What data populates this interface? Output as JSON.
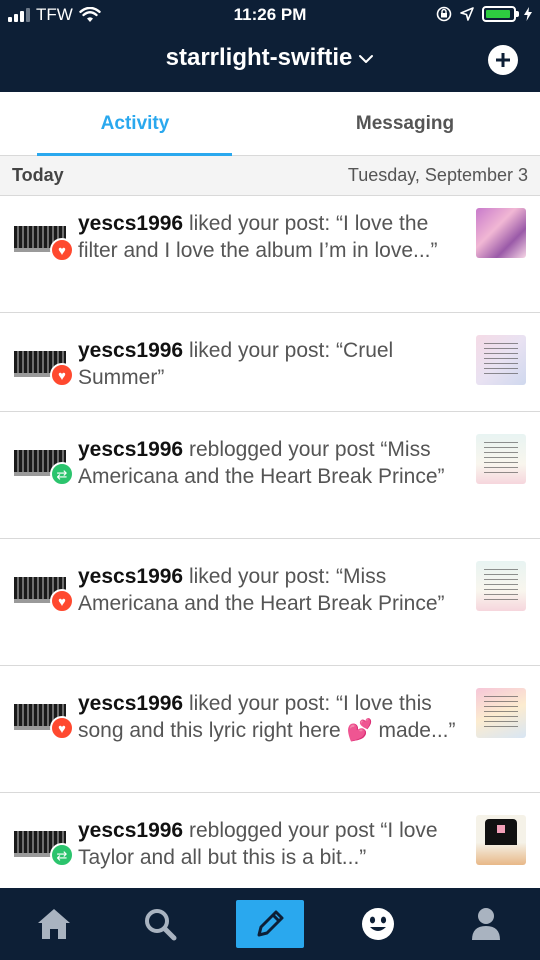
{
  "status_bar": {
    "carrier": "TFW",
    "time": "11:26 PM"
  },
  "header": {
    "blog_name": "starrlight-swiftie",
    "dropdown_icon": "chevron-down-icon",
    "compose_icon": "plus-circle-icon"
  },
  "tabs": [
    {
      "label": "Activity",
      "active": true
    },
    {
      "label": "Messaging",
      "active": false
    }
  ],
  "section": {
    "title": "Today",
    "date": "Tuesday, September 3"
  },
  "notifications": [
    {
      "user": "yescs1996",
      "text": "liked your post: “I love the filter and I love the album I’m in love...”",
      "type": "like",
      "icon": "heart-icon"
    },
    {
      "user": "yescs1996",
      "text": "liked your post: “Cruel Summer”",
      "type": "like",
      "icon": "heart-icon"
    },
    {
      "user": "yescs1996",
      "text": "reblogged your post “Miss Americana and the Heart Break Prince”",
      "type": "reblog",
      "icon": "reblog-icon"
    },
    {
      "user": "yescs1996",
      "text": "liked your post: “Miss Americana and the Heart Break Prince”",
      "type": "like",
      "icon": "heart-icon"
    },
    {
      "user": "yescs1996",
      "text": "liked your post: “I love this song and this lyric right here 💕 made...”",
      "type": "like",
      "icon": "heart-icon"
    },
    {
      "user": "yescs1996",
      "text": "reblogged your post “I love Taylor and all but this is a bit...”",
      "type": "reblog",
      "icon": "reblog-icon"
    }
  ],
  "bottom_nav": [
    {
      "icon": "home-icon"
    },
    {
      "icon": "search-icon"
    },
    {
      "icon": "pencil-icon"
    },
    {
      "icon": "smiley-icon"
    },
    {
      "icon": "person-icon"
    }
  ],
  "colors": {
    "header_bg": "#0d1f36",
    "accent": "#2aa8ee",
    "like": "#ff492f",
    "reblog": "#2bc46d"
  }
}
